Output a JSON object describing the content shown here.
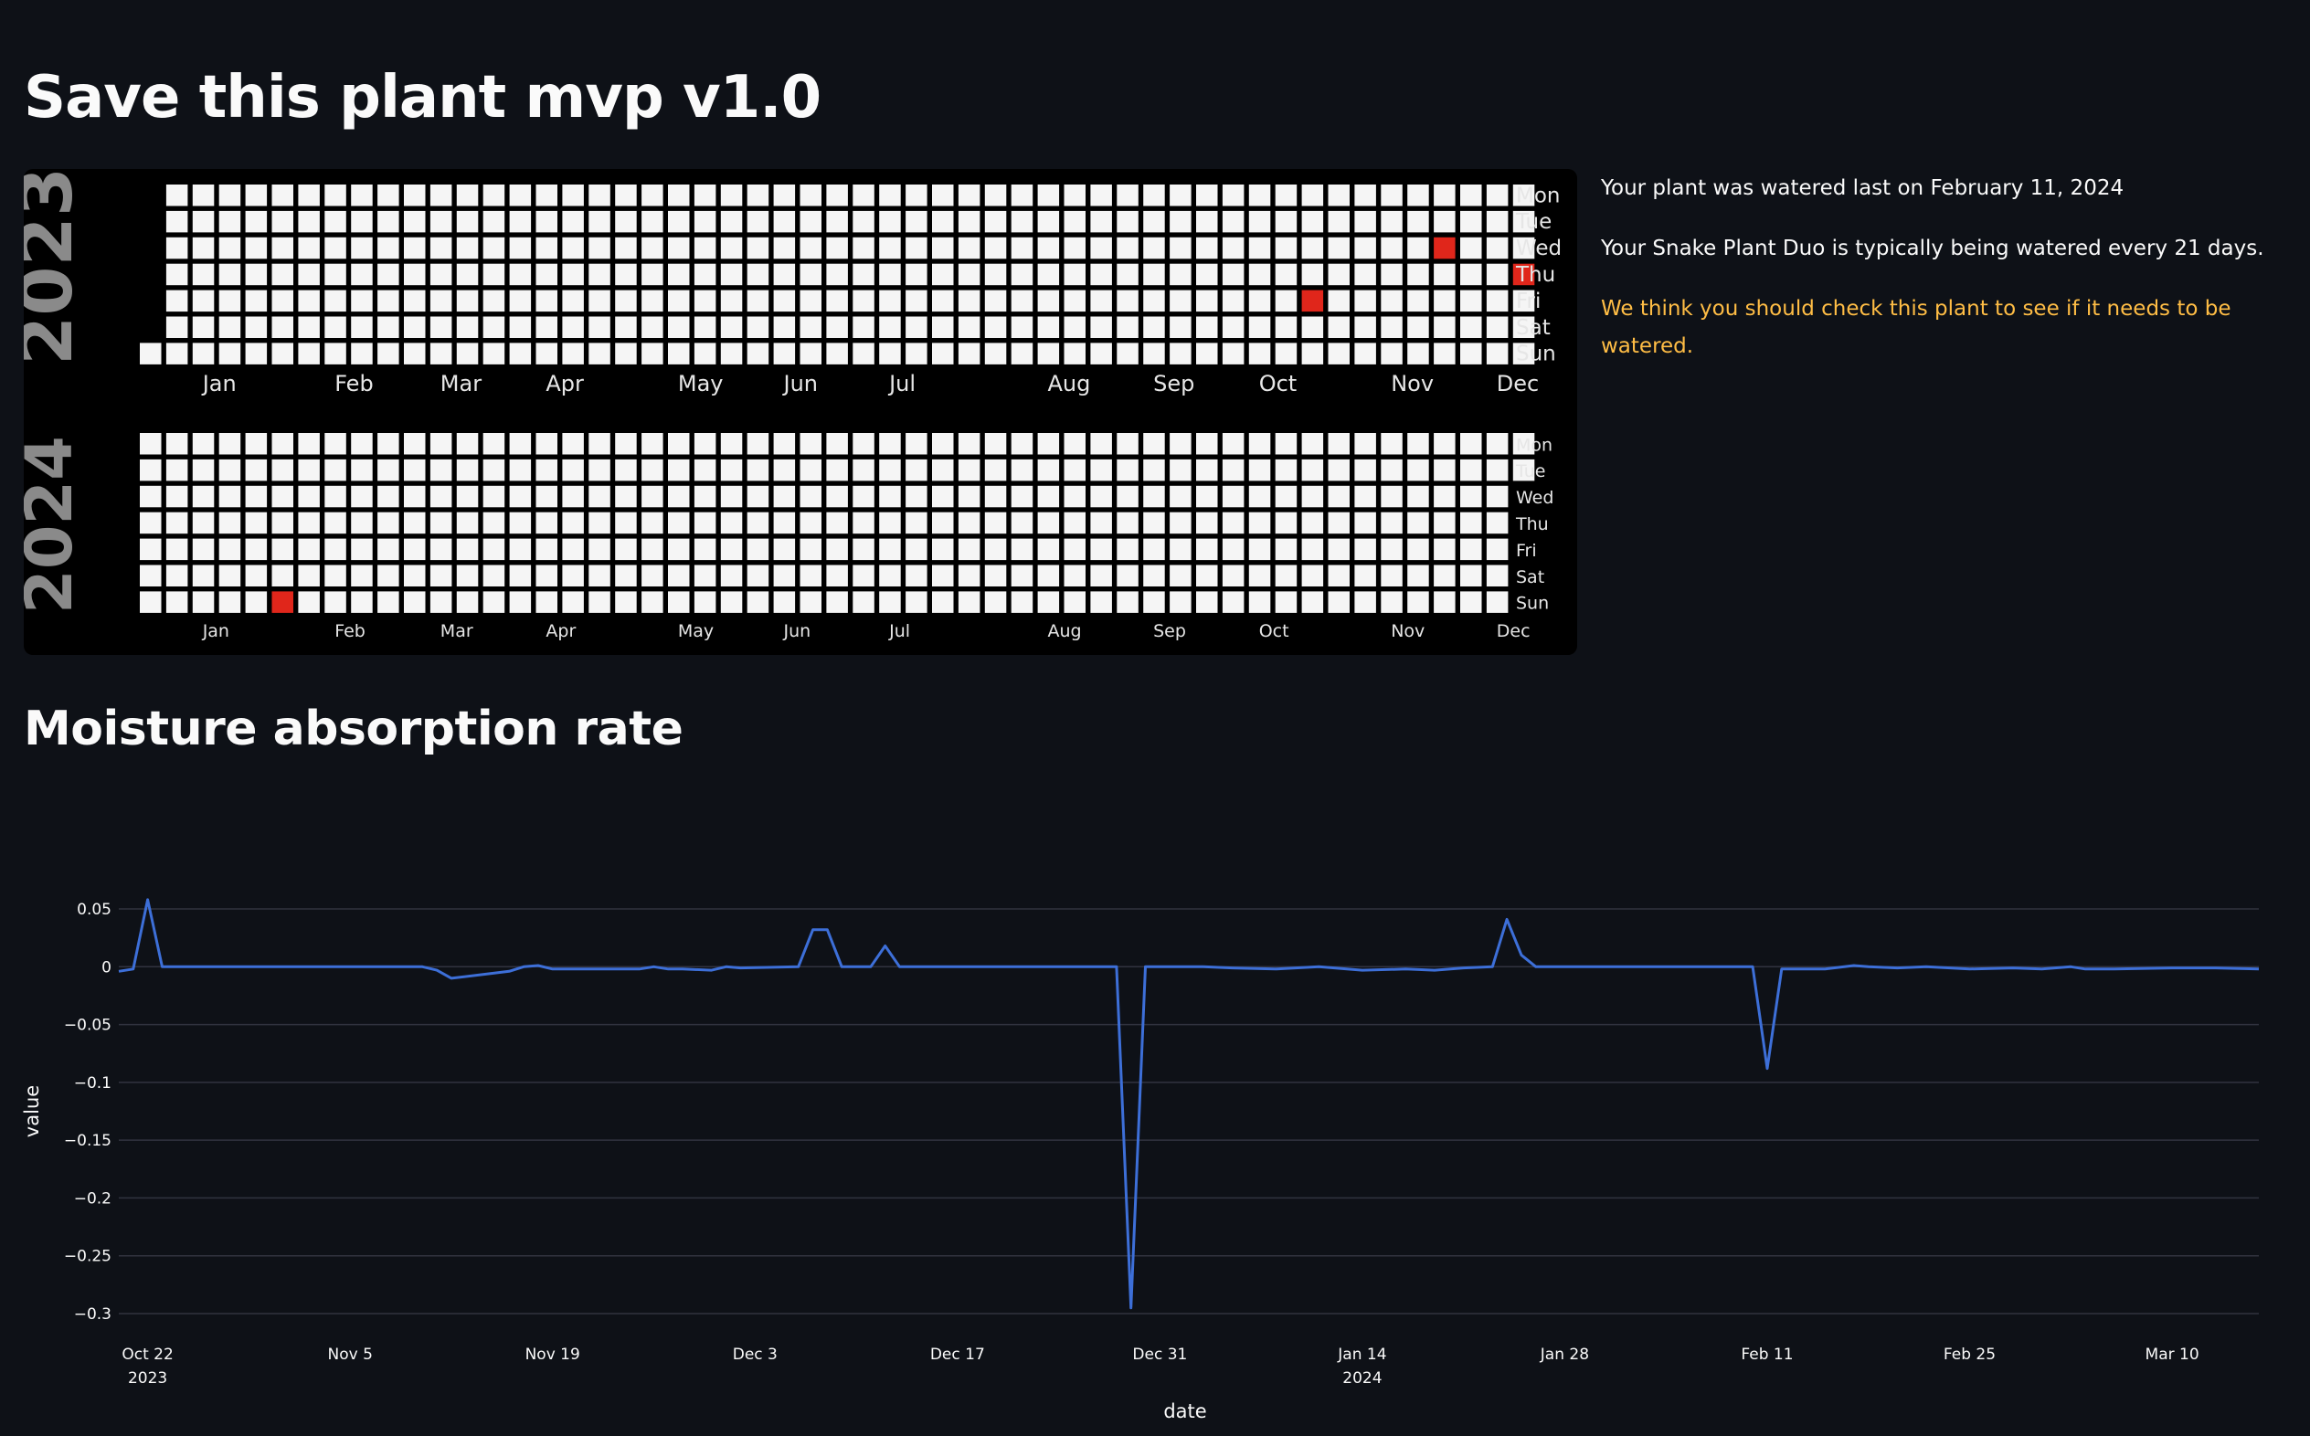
{
  "title": "Save this plant mvp v1.0",
  "heatmap": {
    "years": [
      {
        "year": "2023",
        "start_weekday_offset": 6,
        "watered_days": [
          "2023-11-03",
          "2023-12-06",
          "2023-12-28"
        ],
        "weekday_labels": [
          "Mon",
          "Tue",
          "Wed",
          "Thu",
          "Fri",
          "Sat",
          "Sun"
        ],
        "month_labels": [
          "Jan",
          "Feb",
          "Mar",
          "Apr",
          "May",
          "Jun",
          "Jul",
          "Aug",
          "Sep",
          "Oct",
          "Nov",
          "Dec"
        ]
      },
      {
        "year": "2024",
        "start_weekday_offset": 0,
        "watered_days": [
          "2024-02-11"
        ],
        "weekday_labels": [
          "Mon",
          "Tue",
          "Wed",
          "Thu",
          "Fri",
          "Sat",
          "Sun"
        ],
        "month_labels": [
          "Jan",
          "Feb",
          "Mar",
          "Apr",
          "May",
          "Jun",
          "Jul",
          "Aug",
          "Sep",
          "Oct",
          "Nov",
          "Dec"
        ]
      }
    ],
    "colors": {
      "empty": "#f5f5f5",
      "watered": "#e0261b",
      "background": "#000000",
      "year_label": "#8a8a8a"
    }
  },
  "info": {
    "last_watered": "Your plant was watered last on February 11, 2024",
    "typical": "Your Snake Plant Duo is typically being watered every 21 days.",
    "warning": "We think you should check this plant to see if it needs to be watered.",
    "warning_color": "#ffbd45"
  },
  "moisture_title": "Moisture absorption rate",
  "chart_data": {
    "type": "line",
    "title": "",
    "xlabel": "date",
    "ylabel": "value",
    "ylim": [
      -0.3,
      0.05
    ],
    "y_ticks": [
      0.05,
      0,
      -0.05,
      -0.1,
      -0.15,
      -0.2,
      -0.25,
      -0.3
    ],
    "y_tick_labels": [
      "0.05",
      "0",
      "−0.05",
      "−0.1",
      "−0.15",
      "−0.2",
      "−0.25",
      "−0.3"
    ],
    "x_ticks": [
      {
        "date": "2023-10-22",
        "label": "Oct 22",
        "sublabel": "2023"
      },
      {
        "date": "2023-11-05",
        "label": "Nov 5",
        "sublabel": ""
      },
      {
        "date": "2023-11-19",
        "label": "Nov 19",
        "sublabel": ""
      },
      {
        "date": "2023-12-03",
        "label": "Dec 3",
        "sublabel": ""
      },
      {
        "date": "2023-12-17",
        "label": "Dec 17",
        "sublabel": ""
      },
      {
        "date": "2023-12-31",
        "label": "Dec 31",
        "sublabel": ""
      },
      {
        "date": "2024-01-14",
        "label": "Jan 14",
        "sublabel": "2024"
      },
      {
        "date": "2024-01-28",
        "label": "Jan 28",
        "sublabel": ""
      },
      {
        "date": "2024-02-11",
        "label": "Feb 11",
        "sublabel": ""
      },
      {
        "date": "2024-02-25",
        "label": "Feb 25",
        "sublabel": ""
      },
      {
        "date": "2024-03-10",
        "label": "Mar 10",
        "sublabel": ""
      }
    ],
    "x_range": [
      "2023-10-20",
      "2024-03-16"
    ],
    "line_color": "#3d6fd8",
    "series": [
      {
        "x": [
          "2023-10-20",
          "2023-10-21",
          "2023-10-22",
          "2023-10-23",
          "2023-11-10",
          "2023-11-11",
          "2023-11-12",
          "2023-11-16",
          "2023-11-17",
          "2023-11-18",
          "2023-11-19",
          "2023-11-25",
          "2023-11-26",
          "2023-11-27",
          "2023-11-28",
          "2023-11-30",
          "2023-12-01",
          "2023-12-02",
          "2023-12-06",
          "2023-12-07",
          "2023-12-08",
          "2023-12-09",
          "2023-12-11",
          "2023-12-12",
          "2023-12-13",
          "2023-12-28",
          "2023-12-29",
          "2023-12-30",
          "2024-01-03",
          "2024-01-05",
          "2024-01-08",
          "2024-01-11",
          "2024-01-14",
          "2024-01-17",
          "2024-01-19",
          "2024-01-21",
          "2024-01-23",
          "2024-01-24",
          "2024-01-25",
          "2024-01-26",
          "2024-01-27",
          "2024-02-05",
          "2024-02-10",
          "2024-02-11",
          "2024-02-12",
          "2024-02-15",
          "2024-02-17",
          "2024-02-18",
          "2024-02-20",
          "2024-02-22",
          "2024-02-25",
          "2024-02-28",
          "2024-03-01",
          "2024-03-03",
          "2024-03-04",
          "2024-03-06",
          "2024-03-10",
          "2024-03-13",
          "2024-03-16"
        ],
        "y": [
          -0.004,
          -0.002,
          0.058,
          0.0,
          0.0,
          -0.003,
          -0.01,
          -0.004,
          0.0,
          0.001,
          -0.002,
          -0.002,
          0.0,
          -0.002,
          -0.002,
          -0.003,
          0.0,
          -0.001,
          0.0,
          0.032,
          0.032,
          0.0,
          0.0,
          0.018,
          0.0,
          0.0,
          -0.295,
          0.0,
          0.0,
          -0.001,
          -0.002,
          0.0,
          -0.003,
          -0.002,
          -0.003,
          -0.001,
          0.0,
          0.041,
          0.01,
          0.0,
          0.0,
          0.0,
          0.0,
          -0.088,
          -0.002,
          -0.002,
          0.001,
          0.0,
          -0.001,
          0.0,
          -0.002,
          -0.001,
          -0.002,
          0.0,
          -0.002,
          -0.002,
          -0.001,
          -0.001,
          -0.002
        ]
      }
    ]
  }
}
